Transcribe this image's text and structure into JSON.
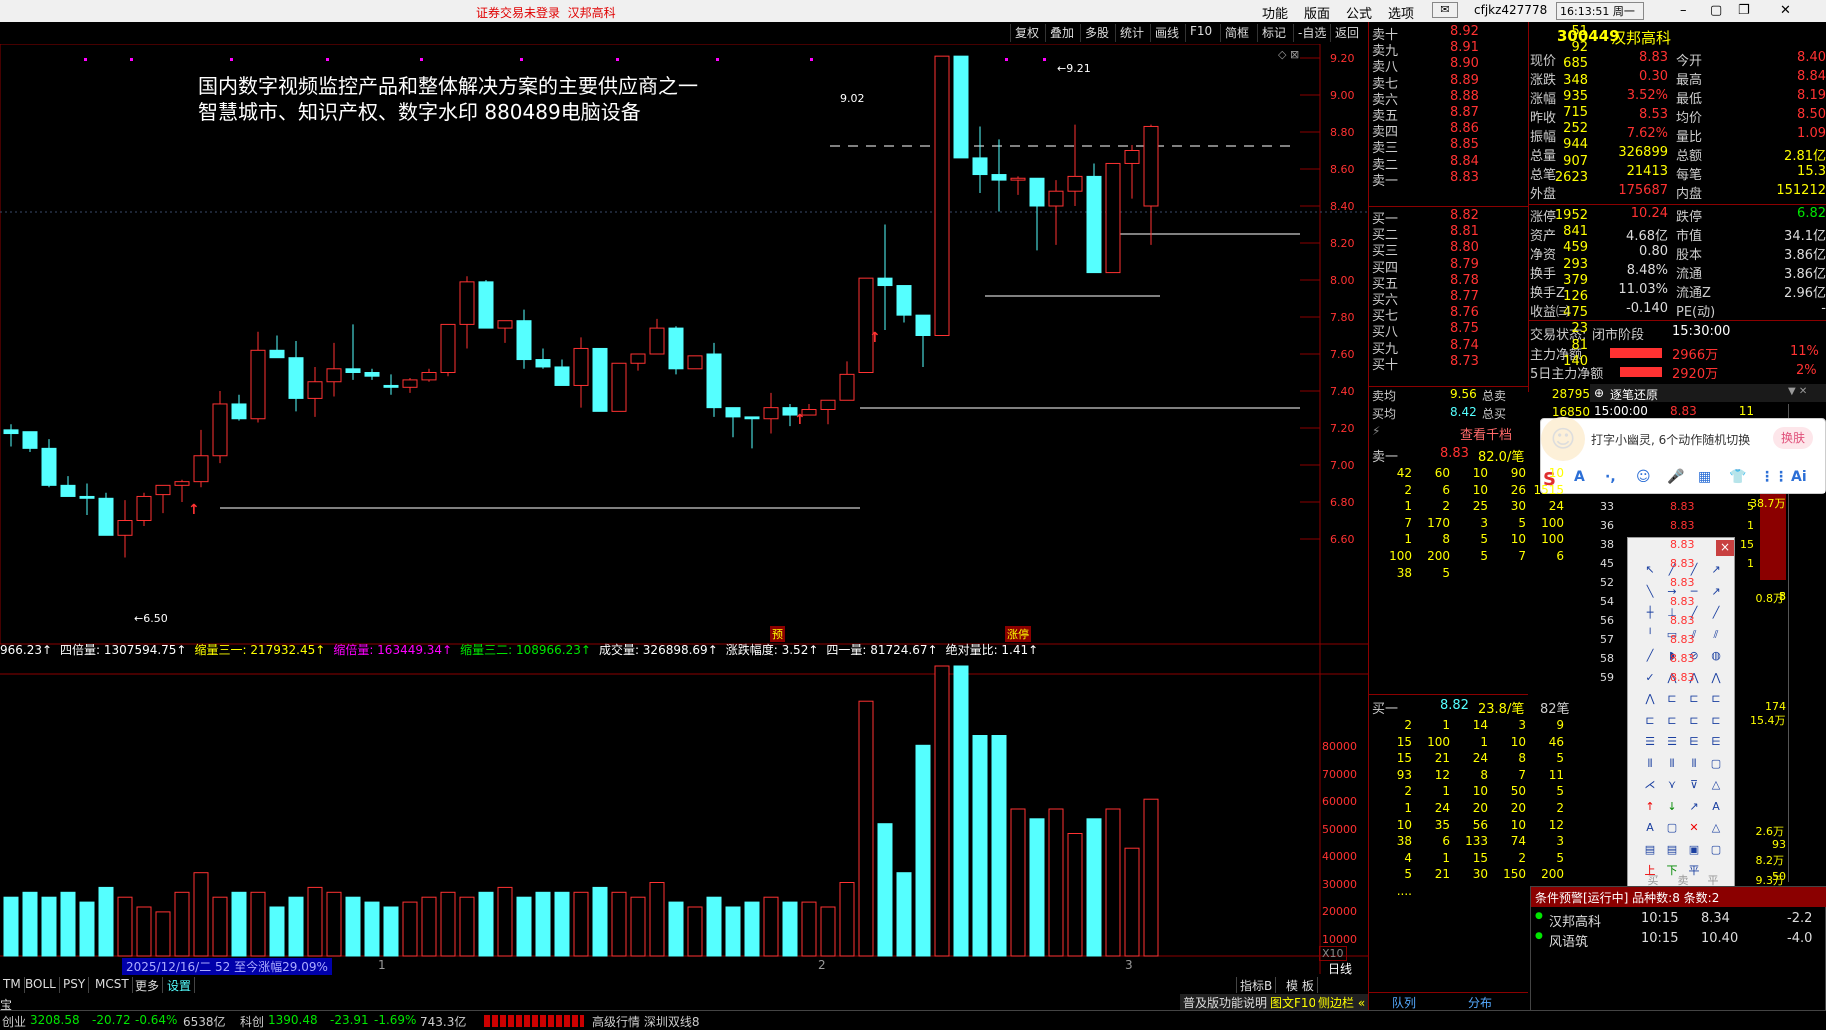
{
  "topbar": {
    "warning": "证券交易未登录",
    "stock": "汉邦高科",
    "menus": [
      "功能",
      "版面",
      "公式",
      "选项"
    ],
    "user": "cfjkz427778",
    "clock": "16:13:51 周一"
  },
  "toolbar": {
    "buttons": [
      "复权",
      "叠加",
      "多股",
      "统计",
      "画线",
      "F10",
      "简框",
      "标记",
      "-自选",
      "返回"
    ]
  },
  "chart": {
    "annotation_line1": "国内数字视频监控产品和整体解决方案的主要供应商之一",
    "annotation_line2": "智慧城市、知识产权、数字水印   880489电脑设备",
    "price_labels": [
      "9.20",
      "9.00",
      "8.80",
      "8.60",
      "8.40",
      "8.20",
      "8.00",
      "7.80",
      "7.60",
      "7.40",
      "7.20",
      "7.00",
      "6.80",
      "6.60"
    ],
    "hi_marker": "9.21",
    "lo_marker": "6.50",
    "ref_label": "9.02",
    "pre_tag": "预",
    "zt_tag": "涨停",
    "vol_labels": [
      "80000",
      "70000",
      "60000",
      "50000",
      "40000",
      "30000",
      "20000",
      "10000"
    ],
    "vol_unit": "X10",
    "indicator_line": [
      {
        "text": "966.23↑",
        "color": "#ffffff"
      },
      {
        "text": "四倍量: 1307594.75↑",
        "color": "#ffffff"
      },
      {
        "text": "缩量三一: 217932.45↑",
        "color": "#ffff00"
      },
      {
        "text": "缩倍量: 163449.34↑",
        "color": "#ff00ff"
      },
      {
        "text": "缩量三二: 108966.23↑",
        "color": "#00e600"
      },
      {
        "text": "成交量: 326898.69↑",
        "color": "#ffffff"
      },
      {
        "text": "涨跌幅度: 3.52↑",
        "color": "#ffffff"
      },
      {
        "text": "四一量: 81724.67↑",
        "color": "#ffffff"
      },
      {
        "text": "绝对量比: 1.41↑",
        "color": "#ffffff"
      }
    ],
    "date_range": "2025/12/16/二 52 至今涨幅29.09%",
    "month_labels": [
      "1",
      "2",
      "3"
    ],
    "period": "日线",
    "index_btns": [
      "指标B",
      "模 板"
    ]
  },
  "order_book": {
    "asks": [
      {
        "l": "卖十",
        "p": "8.92",
        "v": "51"
      },
      {
        "l": "卖九",
        "p": "8.91",
        "v": "92"
      },
      {
        "l": "卖八",
        "p": "8.90",
        "v": "685"
      },
      {
        "l": "卖七",
        "p": "8.89",
        "v": "348"
      },
      {
        "l": "卖六",
        "p": "8.88",
        "v": "935"
      },
      {
        "l": "卖五",
        "p": "8.87",
        "v": "715"
      },
      {
        "l": "卖四",
        "p": "8.86",
        "v": "252"
      },
      {
        "l": "卖三",
        "p": "8.85",
        "v": "944"
      },
      {
        "l": "卖二",
        "p": "8.84",
        "v": "907"
      },
      {
        "l": "卖一",
        "p": "8.83",
        "v": "2623"
      }
    ],
    "bids": [
      {
        "l": "买一",
        "p": "8.82",
        "v": "1952"
      },
      {
        "l": "买二",
        "p": "8.81",
        "v": "841"
      },
      {
        "l": "买三",
        "p": "8.80",
        "v": "459"
      },
      {
        "l": "买四",
        "p": "8.79",
        "v": "293"
      },
      {
        "l": "买五",
        "p": "8.78",
        "v": "379"
      },
      {
        "l": "买六",
        "p": "8.77",
        "v": "126"
      },
      {
        "l": "买七",
        "p": "8.76",
        "v": "475"
      },
      {
        "l": "买八",
        "p": "8.75",
        "v": "23"
      },
      {
        "l": "买九",
        "p": "8.74",
        "v": "81"
      },
      {
        "l": "买十",
        "p": "8.73",
        "v": "140"
      }
    ],
    "avg_sell": {
      "l": "卖均",
      "p": "9.56",
      "t": "总卖",
      "v": "28795"
    },
    "avg_buy": {
      "l": "买均",
      "p": "8.42",
      "t": "总买",
      "v": "16850"
    },
    "view_more": "查看千档",
    "ask1_header": {
      "l": "卖一",
      "p": "8.83",
      "q": "82.0/笔"
    },
    "ask1_queue": [
      [
        "42",
        "60",
        "10",
        "90",
        "10"
      ],
      [
        "2",
        "6",
        "10",
        "26",
        "1515"
      ],
      [
        "1",
        "2",
        "25",
        "30",
        "24"
      ],
      [
        "7",
        "170",
        "3",
        "5",
        "100"
      ],
      [
        "1",
        "8",
        "5",
        "10",
        "100"
      ],
      [
        "100",
        "200",
        "5",
        "7",
        "6"
      ],
      [
        "38",
        "5",
        "",
        "",
        ""
      ]
    ],
    "bid1_header": {
      "l": "买一",
      "p": "8.82",
      "q": "23.8/笔",
      "n": "82笔"
    },
    "bid1_queue": [
      [
        "2",
        "1",
        "14",
        "3",
        "9"
      ],
      [
        "15",
        "100",
        "1",
        "10",
        "46"
      ],
      [
        "15",
        "21",
        "24",
        "8",
        "5"
      ],
      [
        "93",
        "12",
        "8",
        "7",
        "11"
      ],
      [
        "2",
        "1",
        "10",
        "50",
        "5"
      ],
      [
        "1",
        "24",
        "20",
        "20",
        "2"
      ],
      [
        "10",
        "35",
        "56",
        "10",
        "12"
      ],
      [
        "38",
        "6",
        "133",
        "74",
        "3"
      ],
      [
        "4",
        "1",
        "15",
        "2",
        "5"
      ],
      [
        "5",
        "21",
        "30",
        "150",
        "200"
      ],
      [
        "....",
        "",
        "",
        "",
        ""
      ]
    ],
    "tabs": [
      "队列",
      "分布"
    ]
  },
  "quote": {
    "code": "300449",
    "name": "汉邦高科",
    "rows": [
      {
        "a": "现价",
        "av": "8.83",
        "b": "今开",
        "bv": "8.40"
      },
      {
        "a": "涨跌",
        "av": "0.30",
        "b": "最高",
        "bv": "8.84"
      },
      {
        "a": "涨幅",
        "av": "3.52%",
        "b": "最低",
        "bv": "8.19"
      },
      {
        "a": "昨收",
        "av": "8.53",
        "b": "均价",
        "bv": "8.50"
      },
      {
        "a": "振幅",
        "av": "7.62%",
        "b": "量比",
        "bv": "1.09"
      },
      {
        "a": "总量",
        "av": "326899",
        "b": "总额",
        "bv": "2.81亿"
      },
      {
        "a": "总笔",
        "av": "21413",
        "b": "每笔",
        "bv": "15.3"
      },
      {
        "a": "外盘",
        "av": "175687",
        "b": "内盘",
        "bv": "151212"
      }
    ],
    "rows2": [
      {
        "a": "涨停",
        "av": "10.24",
        "b": "跌停",
        "bv": "6.82"
      },
      {
        "a": "资产",
        "av": "4.68亿",
        "b": "市值",
        "bv": "34.1亿"
      },
      {
        "a": "净资",
        "av": "0.80",
        "b": "股本",
        "bv": "3.86亿"
      },
      {
        "a": "换手",
        "av": "8.48%",
        "b": "流通",
        "bv": "3.86亿"
      },
      {
        "a": "换手Z",
        "av": "11.03%",
        "b": "流通Z",
        "bv": "2.96亿"
      },
      {
        "a": "收益㈢",
        "av": "-0.140",
        "b": "PE(动)",
        "bv": "-"
      }
    ],
    "trade_status_label": "交易状态:",
    "trade_status": "闭市阶段",
    "trade_time": "15:30:00",
    "main_net": {
      "l": "主力净额",
      "v": "2966万",
      "p": "11%"
    },
    "main_net5": {
      "l": "5日主力净额",
      "v": "2920万",
      "p": "2%"
    }
  },
  "ticks": {
    "title": "逐笔还原",
    "header_time": "15:00:00",
    "header_price": "8.83",
    "header_vol": "11",
    "rows": [
      {
        "t": "33",
        "p": "8.83",
        "v": "5"
      },
      {
        "t": "36",
        "p": "8.83",
        "v": "1"
      },
      {
        "t": "38",
        "p": "8.83",
        "v": "15"
      },
      {
        "t": "45",
        "p": "8.83",
        "v": "1"
      },
      {
        "t": "52",
        "p": "8.83",
        "v": ""
      },
      {
        "t": "54",
        "p": "8.83",
        "v": ""
      },
      {
        "t": "56",
        "p": "8.83",
        "v": ""
      },
      {
        "t": "57",
        "p": "8.83",
        "v": ""
      },
      {
        "t": "58",
        "p": "8.83",
        "v": ""
      },
      {
        "t": "59",
        "p": "8.83",
        "v": ""
      }
    ],
    "side_vals": [
      "38.7万",
      "5",
      "0.8万",
      "174",
      "15.4万",
      "8",
      "2.6万",
      "93",
      "8.2万",
      "50",
      "9.3万"
    ]
  },
  "ime": {
    "tip": "打字小幽灵, 6个动作随机切换",
    "switch_btn": "换肤",
    "bar_items": [
      "S",
      "A",
      "·,",
      "☺",
      "🎤",
      "▦",
      "👕",
      "⋮⋮",
      "Ai"
    ]
  },
  "tool_palette": {
    "close": "×",
    "footer": [
      "买",
      "卖",
      "平"
    ]
  },
  "alerts": {
    "title": "条件预警[运行中] 品种数:8 条数:2",
    "rows": [
      {
        "name": "汉邦高科",
        "time": "10:15",
        "price": "8.34",
        "chg": "-2.2"
      },
      {
        "name": "风语筑",
        "time": "10:15",
        "price": "10.40",
        "chg": "-4.0"
      }
    ]
  },
  "bottom_tabs": [
    "TM",
    "BOLL",
    "PSY",
    "MCST",
    "更多",
    "设置"
  ],
  "bottom_right": {
    "a": "普及版功能说明",
    "b": "图文F10",
    "c": "侧边栏 «"
  },
  "status": {
    "idx1_name": "创业",
    "idx1_val": "3208.58",
    "idx1_chg": "-20.72",
    "idx1_pct": "-0.64%",
    "idx1_amt": "6538亿",
    "idx2_name": "科创",
    "idx2_val": "1390.48",
    "idx2_chg": "-23.91",
    "idx2_pct": "-1.69%",
    "idx2_amt": "743.3亿",
    "extra": "高级行情  深圳双线8",
    "left_char": "宝"
  },
  "colors": {
    "up": "#ff3232",
    "down": "#55ffff",
    "grid": "#8b0000"
  }
}
